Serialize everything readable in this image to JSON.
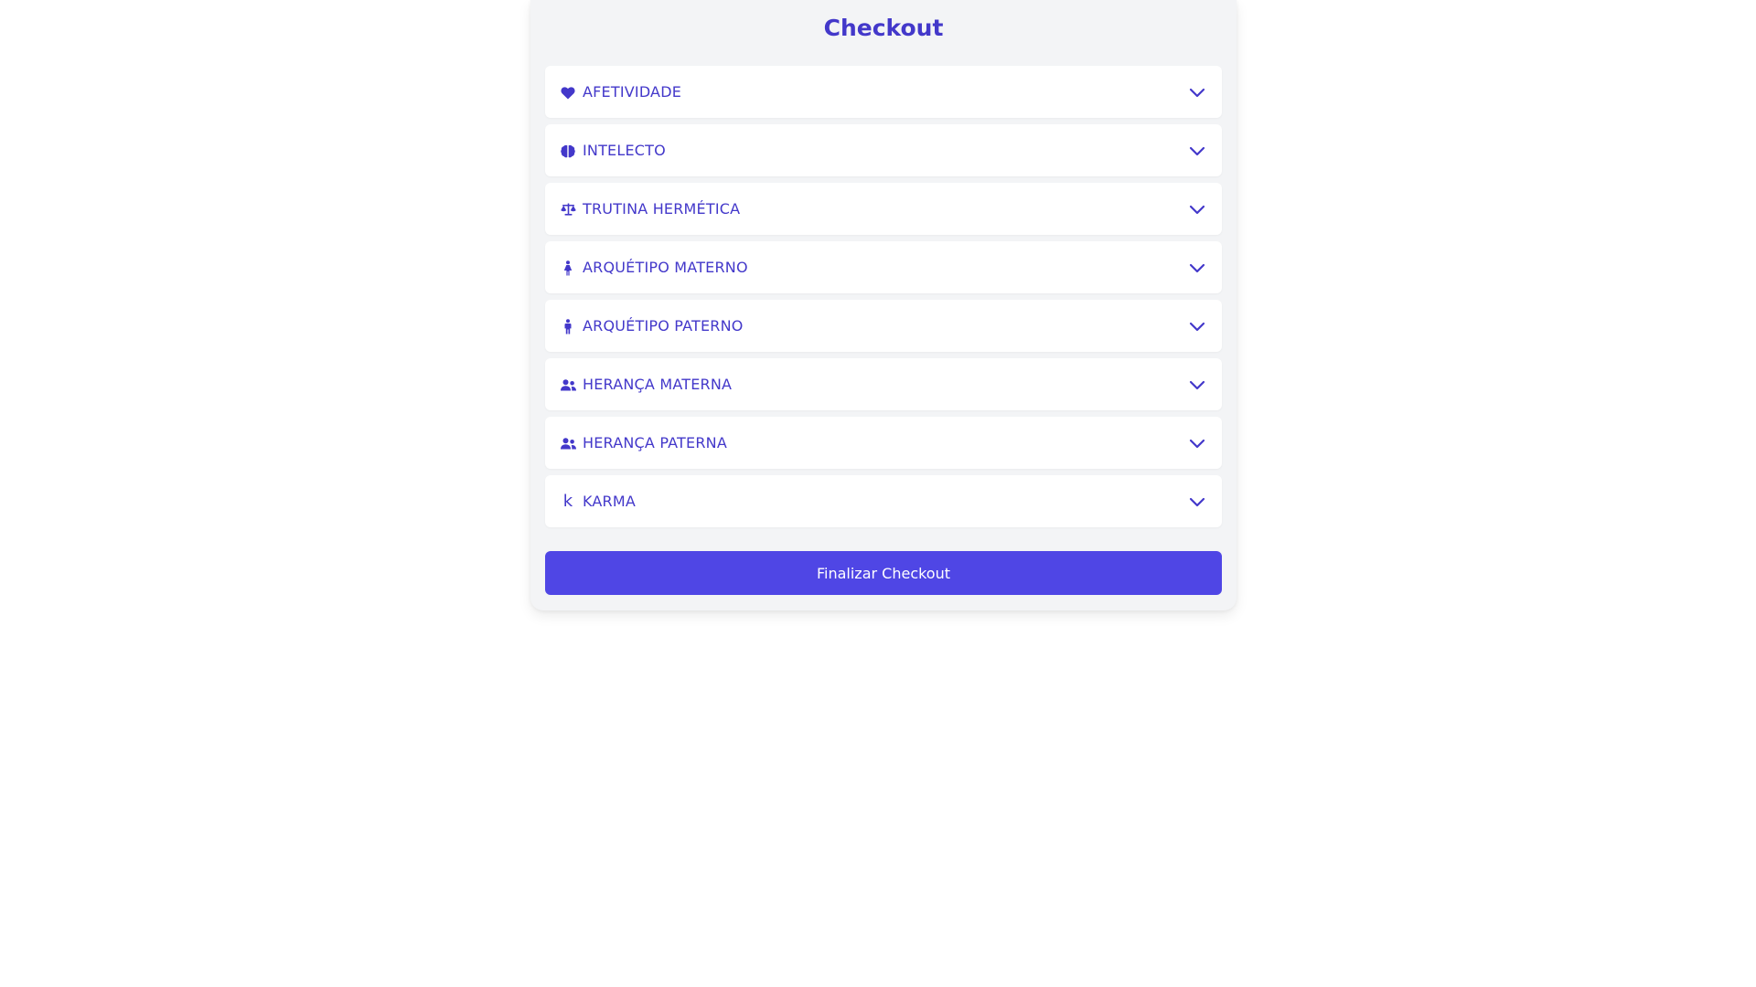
{
  "checkout": {
    "title": "Checkout",
    "accent_color": "#4338ca",
    "button_color": "#4f46e5",
    "sections": [
      {
        "label": "AFETIVIDADE",
        "icon": "heart-icon"
      },
      {
        "label": "INTELECTO",
        "icon": "brain-icon"
      },
      {
        "label": "TRUTINA HERMÉTICA",
        "icon": "scale-balanced-icon"
      },
      {
        "label": "ARQUÉTIPO MATERNO",
        "icon": "person-dress-icon"
      },
      {
        "label": "ARQUÉTIPO PATERNO",
        "icon": "person-icon"
      },
      {
        "label": "HERANÇA MATERNA",
        "icon": "user-group-icon"
      },
      {
        "label": "HERANÇA PATERNA",
        "icon": "user-group-icon"
      },
      {
        "label": "KARMA",
        "icon": "k-icon",
        "icon_glyph": "k"
      }
    ],
    "finalize_label": "Finalizar Checkout"
  }
}
